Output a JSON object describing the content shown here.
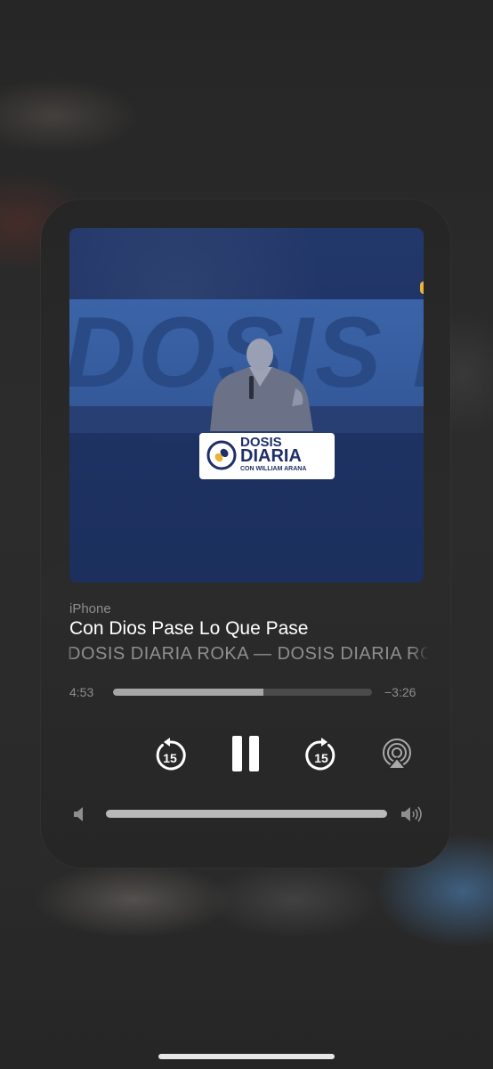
{
  "player": {
    "device": "iPhone",
    "title": "Con Dios Pase Lo Que Pase",
    "artist": "DOSIS DIARIA ROKA — DOSIS DIARIA ROKA",
    "elapsed": "4:53",
    "remaining": "−3:26",
    "progress": 0.58,
    "volume": 1.0,
    "skip_back_seconds": "15",
    "skip_forward_seconds": "15",
    "state": "playing"
  },
  "artwork": {
    "logo_line1": "DOSIS",
    "logo_line2": "DIARIA",
    "logo_line3": "CON WILLIAM ARANA",
    "background_word": "DOSIS DIARIA",
    "colors": {
      "background": "#1e3364",
      "band": "#3b64a8",
      "accent": "#e8b431",
      "logo_text": "#1e2f6a"
    }
  },
  "icons": {
    "rewind": "gobackward-15-icon",
    "pause": "pause-icon",
    "forward": "goforward-15-icon",
    "airplay": "airplay-audio-icon",
    "volume_low": "speaker-icon",
    "volume_high": "speaker-wave-icon"
  }
}
